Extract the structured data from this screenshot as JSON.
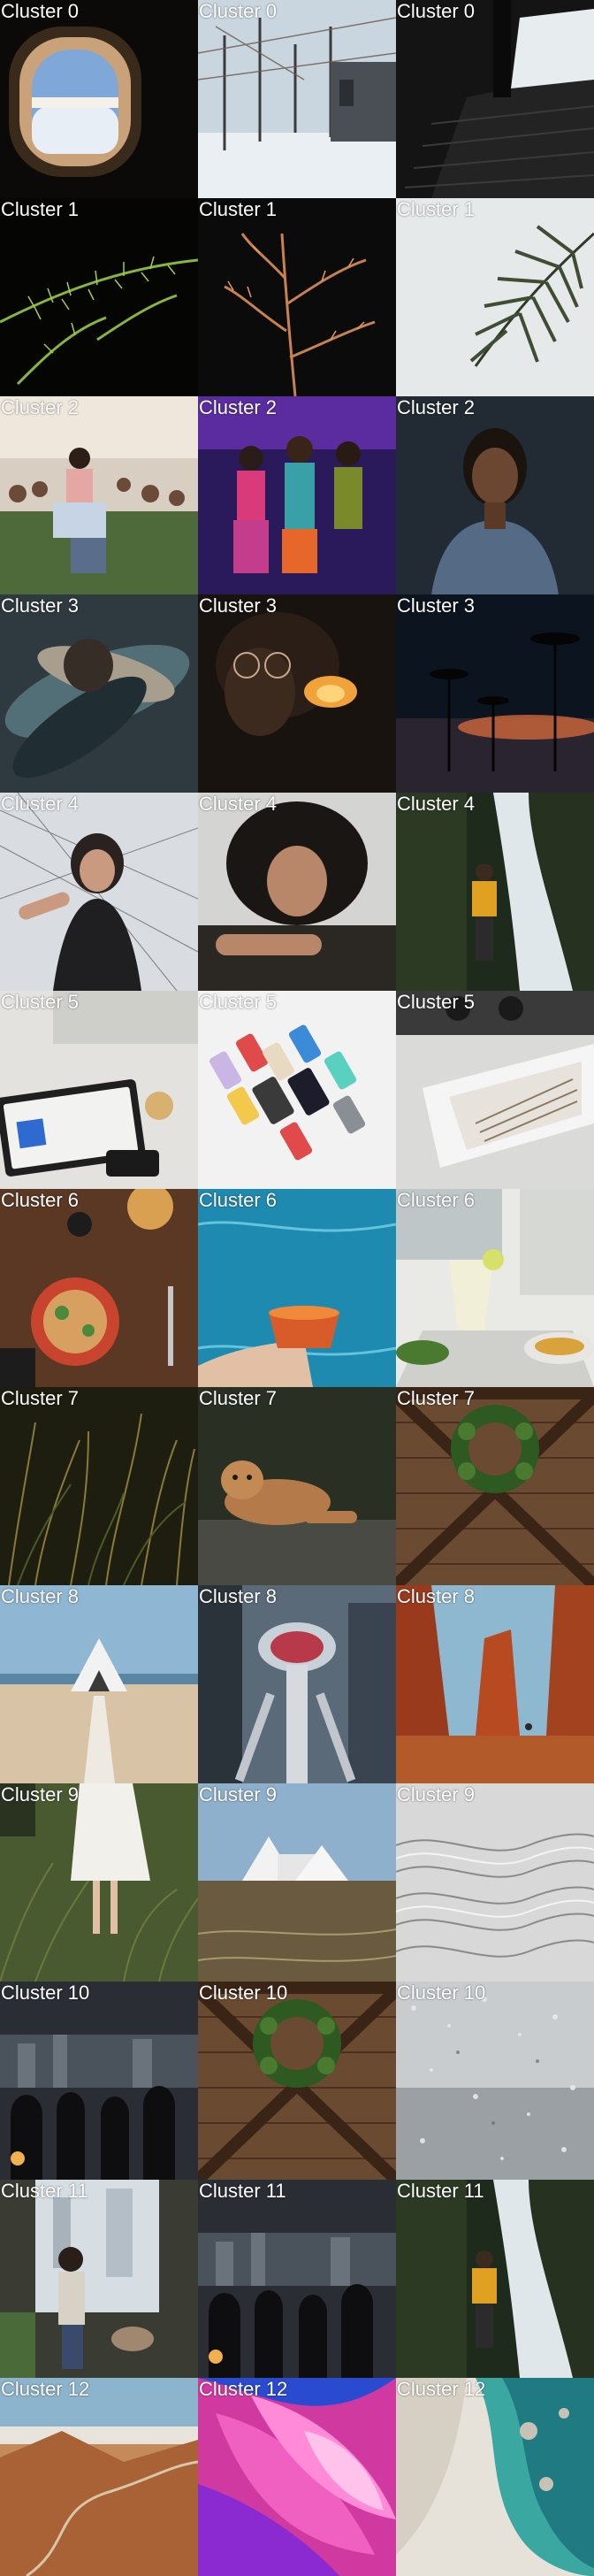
{
  "grid": {
    "tiles": [
      {
        "label": "Cluster 0",
        "scene": "airplane-window"
      },
      {
        "label": "Cluster 0",
        "scene": "snowy-trees"
      },
      {
        "label": "Cluster 0",
        "scene": "dark-stairs"
      },
      {
        "label": "Cluster 1",
        "scene": "green-branch"
      },
      {
        "label": "Cluster 1",
        "scene": "orange-plant"
      },
      {
        "label": "Cluster 1",
        "scene": "palm-leaf"
      },
      {
        "label": "Cluster 2",
        "scene": "festival-crowd"
      },
      {
        "label": "Cluster 2",
        "scene": "neon-party"
      },
      {
        "label": "Cluster 2",
        "scene": "man-portrait"
      },
      {
        "label": "Cluster 3",
        "scene": "motion-blur"
      },
      {
        "label": "Cluster 3",
        "scene": "glasses-portrait"
      },
      {
        "label": "Cluster 3",
        "scene": "palm-sunset"
      },
      {
        "label": "Cluster 4",
        "scene": "woman-tulle"
      },
      {
        "label": "Cluster 4",
        "scene": "curly-hair"
      },
      {
        "label": "Cluster 4",
        "scene": "waterfall-hiker"
      },
      {
        "label": "Cluster 5",
        "scene": "tablet-desk"
      },
      {
        "label": "Cluster 5",
        "scene": "phones-grid"
      },
      {
        "label": "Cluster 5",
        "scene": "kitchen-drawer"
      },
      {
        "label": "Cluster 6",
        "scene": "food-table"
      },
      {
        "label": "Cluster 6",
        "scene": "pool-drink"
      },
      {
        "label": "Cluster 6",
        "scene": "lime-drink"
      },
      {
        "label": "Cluster 7",
        "scene": "tall-grass"
      },
      {
        "label": "Cluster 7",
        "scene": "lioness"
      },
      {
        "label": "Cluster 7",
        "scene": "wreath-door"
      },
      {
        "label": "Cluster 8",
        "scene": "beach-chapel"
      },
      {
        "label": "Cluster 8",
        "scene": "tower-city"
      },
      {
        "label": "Cluster 8",
        "scene": "red-rocks"
      },
      {
        "label": "Cluster 9",
        "scene": "grass-dress"
      },
      {
        "label": "Cluster 9",
        "scene": "chapel-grass"
      },
      {
        "label": "Cluster 9",
        "scene": "gray-waves"
      },
      {
        "label": "Cluster 10",
        "scene": "city-silhouettes"
      },
      {
        "label": "Cluster 10",
        "scene": "wreath-door"
      },
      {
        "label": "Cluster 10",
        "scene": "rain-window"
      },
      {
        "label": "Cluster 11",
        "scene": "window-woman"
      },
      {
        "label": "Cluster 11",
        "scene": "city-silhouettes"
      },
      {
        "label": "Cluster 11",
        "scene": "waterfall-hiker"
      },
      {
        "label": "Cluster 12",
        "scene": "desert-road"
      },
      {
        "label": "Cluster 12",
        "scene": "pink-swirl"
      },
      {
        "label": "Cluster 12",
        "scene": "aerial-coast"
      }
    ]
  }
}
